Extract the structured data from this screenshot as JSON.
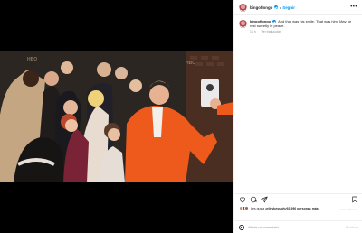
{
  "post": {
    "username": "bingoflongo",
    "follow_label": "Seguir",
    "separator": "•",
    "more_label": "•••",
    "caption": {
      "username": "bingoflongo",
      "text": "And that was his smile. That was him. May he rest sweetly in peace.",
      "time": "16 h",
      "translation_label": "Ver traducción"
    },
    "likes": {
      "prefix": "Les gusta a ",
      "user": "rileykeough",
      "middle": " y ",
      "count": "92.990 personas más"
    },
    "age": "Hace 16 horas",
    "comment": {
      "placeholder": "Añade un comentario...",
      "publish_label": "Publicar"
    },
    "icons": {
      "like": "heart-icon",
      "comment": "comment-icon",
      "share": "share-icon",
      "save": "bookmark-icon",
      "emoji": "emoji-icon",
      "verified": "verified-badge-icon"
    },
    "colors": {
      "link_blue": "#0095f6",
      "text": "#262626",
      "muted": "#8e8e8e",
      "publish_disabled": "#b2dffc"
    }
  }
}
